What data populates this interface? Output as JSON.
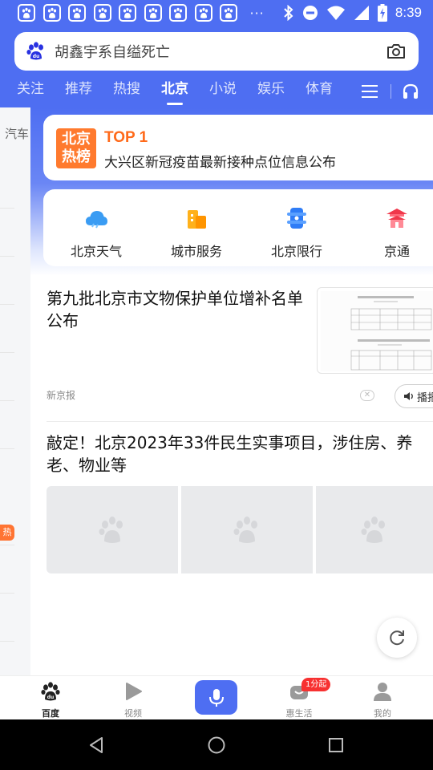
{
  "status_bar": {
    "notification_count": 9,
    "overflow": "···",
    "time": "8:39"
  },
  "search": {
    "query": "胡鑫宇系自缢死亡"
  },
  "tabs": [
    {
      "label": "关注"
    },
    {
      "label": "推荐"
    },
    {
      "label": "热搜"
    },
    {
      "label": "北京",
      "active": true
    },
    {
      "label": "小说"
    },
    {
      "label": "娱乐"
    },
    {
      "label": "体育"
    }
  ],
  "side_peek": {
    "label": "汽车",
    "hot_badge": "热"
  },
  "hot_card": {
    "logo_line1": "北京",
    "logo_line2": "热榜",
    "rank": "TOP 1",
    "title": "大兴区新冠疫苗最新接种点位信息公布"
  },
  "services": [
    {
      "label": "北京天气",
      "icon": "cloud-icon"
    },
    {
      "label": "城市服务",
      "icon": "building-icon"
    },
    {
      "label": "北京限行",
      "icon": "traffic-icon"
    },
    {
      "label": "京通",
      "icon": "pavilion-icon"
    }
  ],
  "news": [
    {
      "title": "第九批北京市文物保护单位增补名单公布",
      "source": "新京报",
      "play_label": "播报"
    },
    {
      "title": "敲定！北京2023年33件民生实事项目，涉住房、养老、物业等"
    }
  ],
  "bottom_nav": [
    {
      "label": "百度",
      "icon": "baidu-paw-icon",
      "active": true
    },
    {
      "label": "视频",
      "icon": "video-icon"
    },
    {
      "label": "",
      "icon": "mic-icon"
    },
    {
      "label": "惠生活",
      "icon": "life-icon",
      "badge": "1分起"
    },
    {
      "label": "我的",
      "icon": "user-icon"
    }
  ],
  "colors": {
    "brand": "#4e6ef2",
    "hot_orange": "#ff6a1a",
    "badge_red": "#f73131"
  }
}
